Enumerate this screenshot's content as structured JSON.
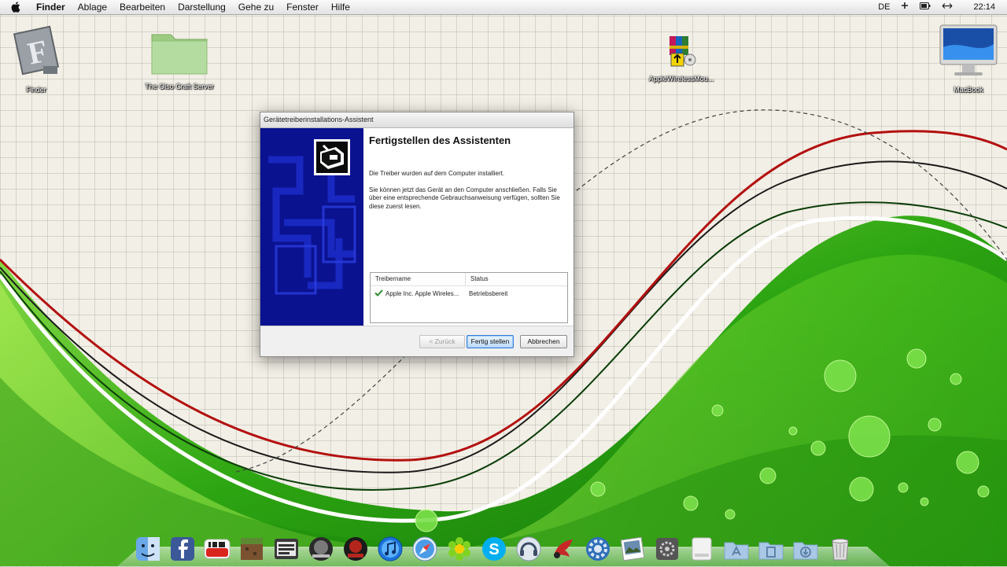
{
  "menubar": {
    "app": "Finder",
    "items": [
      "Ablage",
      "Bearbeiten",
      "Darstellung",
      "Gehe zu",
      "Fenster",
      "Hilfe"
    ],
    "input_lang": "DE",
    "clock": "22:14"
  },
  "desktop": {
    "icons": [
      {
        "label": "Finder"
      },
      {
        "label": "The Olso Craft Server"
      },
      {
        "label": "AppleWirelessMou..."
      },
      {
        "label": "MacBook"
      }
    ]
  },
  "dialog": {
    "title": "Gerätetreiberinstallations-Assistent",
    "heading": "Fertigstellen des Assistenten",
    "text1": "Die Treiber wurden auf dem Computer installiert.",
    "text2": "Sie können jetzt das Gerät an den Computer anschließen. Falls Sie über eine entsprechende Gebrauchsanweisung verfügen, sollten Sie diese zuerst lesen.",
    "table": {
      "headers": [
        "Treibername",
        "Status"
      ],
      "rows": [
        {
          "name": "Apple Inc. Apple Wireles...",
          "status": "Betriebsbereit"
        }
      ]
    },
    "buttons": {
      "back": "< Zurück",
      "finish": "Fertig stellen",
      "cancel": "Abbrechen"
    }
  },
  "dock": {
    "items": [
      "finder-icon",
      "facebook-icon",
      "youtube-icon",
      "minecraft-icon",
      "gta-icon",
      "game-icon",
      "fap-icon",
      "itunes-icon",
      "safari-icon",
      "icq-icon",
      "skype-icon",
      "teamspeak-icon",
      "app-icon",
      "system-preferences-icon",
      "preview-icon",
      "utility-icon",
      "drive-icon",
      "applications-folder-icon",
      "documents-folder-icon",
      "downloads-folder-icon",
      "trash-icon"
    ]
  },
  "colors": {
    "dialog_side": "#0a1290",
    "wallpaper_green": "#2a9a10",
    "accent": "#3a7bd5"
  }
}
